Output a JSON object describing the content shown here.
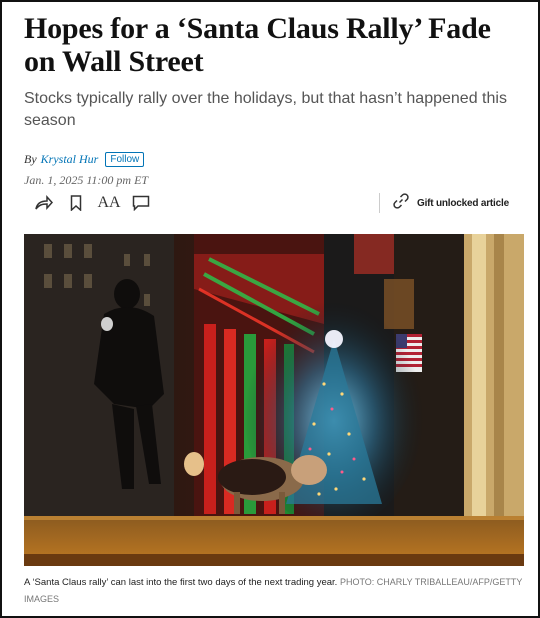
{
  "article": {
    "headline": "Hopes for a ‘Santa Claus Rally’ Fade on Wall Street",
    "dek": "Stocks typically rally over the holidays, but that hasn’t happened this season",
    "byline_prefix": "By",
    "author": "Krystal Hur",
    "follow_label": "Follow",
    "dateline": "Jan. 1, 2025 11:00 pm ET"
  },
  "toolbar": {
    "share_icon": "share-icon",
    "bookmark_icon": "bookmark-icon",
    "text_size_label": "AA",
    "comment_icon": "comment-icon",
    "gift_icon": "link-icon",
    "gift_label": "Gift unlocked article"
  },
  "photo": {
    "caption": "A ‘Santa Claus rally’ can last into the first two days of the next trading year.",
    "credit": "Photo: Charly Triballeau/AFP/Getty Images"
  },
  "colors": {
    "link": "#0274b6",
    "dek": "#555555"
  }
}
